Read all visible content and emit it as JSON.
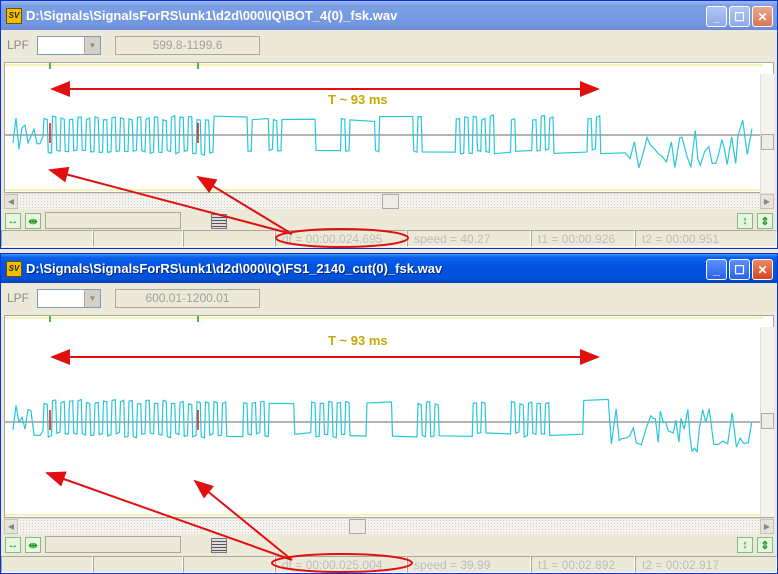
{
  "windows": [
    {
      "title": "D:\\Signals\\SignalsForRS\\unk1\\d2d\\000\\IQ\\BOT_4(0)_fsk.wav",
      "app_icon": "SV",
      "lpf_label": "LPF",
      "lpf_value": "",
      "range": "599.8-1199.6",
      "annotation": "T ~ 93 ms",
      "status": {
        "dt": "dt = 00:00.024.695",
        "speed": "speed = 40.27",
        "t1": "t1 = 00:00.926",
        "t2": "t2 = 00:00.951"
      },
      "active": false
    },
    {
      "title": "D:\\Signals\\SignalsForRS\\unk1\\d2d\\000\\IQ\\FS1_2140_cut(0)_fsk.wav",
      "app_icon": "SV",
      "lpf_label": "LPF",
      "lpf_value": "",
      "range": "600.01-1200.01",
      "annotation": "T ~ 93 ms",
      "status": {
        "dt": "dt = 00:00.025.004",
        "speed": "speed = 39.99",
        "t1": "t1 = 00:02.892",
        "t2": "t2 = 00:02.917"
      },
      "active": true
    }
  ],
  "colors": {
    "signal": "#27c8d8",
    "annotation_arrow": "#e01010",
    "marker_green": "#18a018",
    "marker_red": "#e01010",
    "threshold": "#e8e870"
  }
}
